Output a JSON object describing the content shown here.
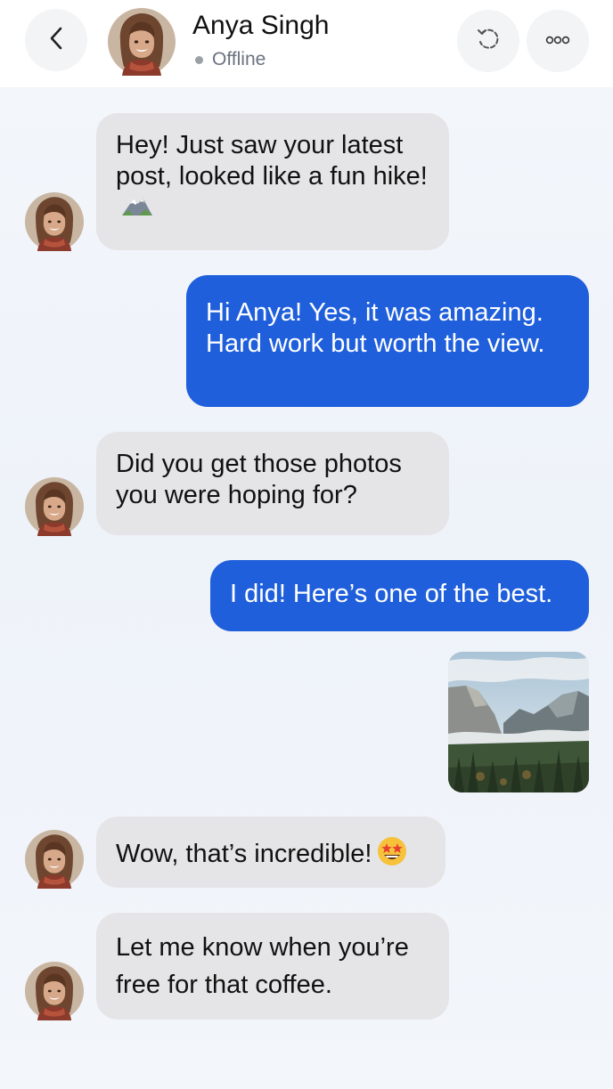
{
  "header": {
    "contact_name": "Anya Singh",
    "status": "Offline",
    "back_icon": "chevron-left-icon",
    "refresh_icon": "refresh-icon",
    "more_icon": "more-icon"
  },
  "messages": [
    {
      "direction": "incoming",
      "text": "Hey! Just saw your latest post, looked like a fun hike!",
      "emoji": "mountain"
    },
    {
      "direction": "outgoing",
      "text": "Hi Anya! Yes, it was amazing. Hard work but worth the view."
    },
    {
      "direction": "incoming",
      "text": "Did you get those photos you were hoping for?"
    },
    {
      "direction": "outgoing",
      "text": "I did! Here’s one of the best."
    },
    {
      "direction": "outgoing",
      "type": "image",
      "image": "mountain valley landscape photo"
    },
    {
      "direction": "incoming",
      "text": "Wow, that’s incredible!",
      "emoji": "star-struck"
    },
    {
      "direction": "incoming",
      "text": "Let me know when you’re free for that coffee."
    }
  ],
  "colors": {
    "outgoing_bubble": "#1f5fdb",
    "incoming_bubble": "#e5e5e7",
    "background": "#eef2f9"
  }
}
